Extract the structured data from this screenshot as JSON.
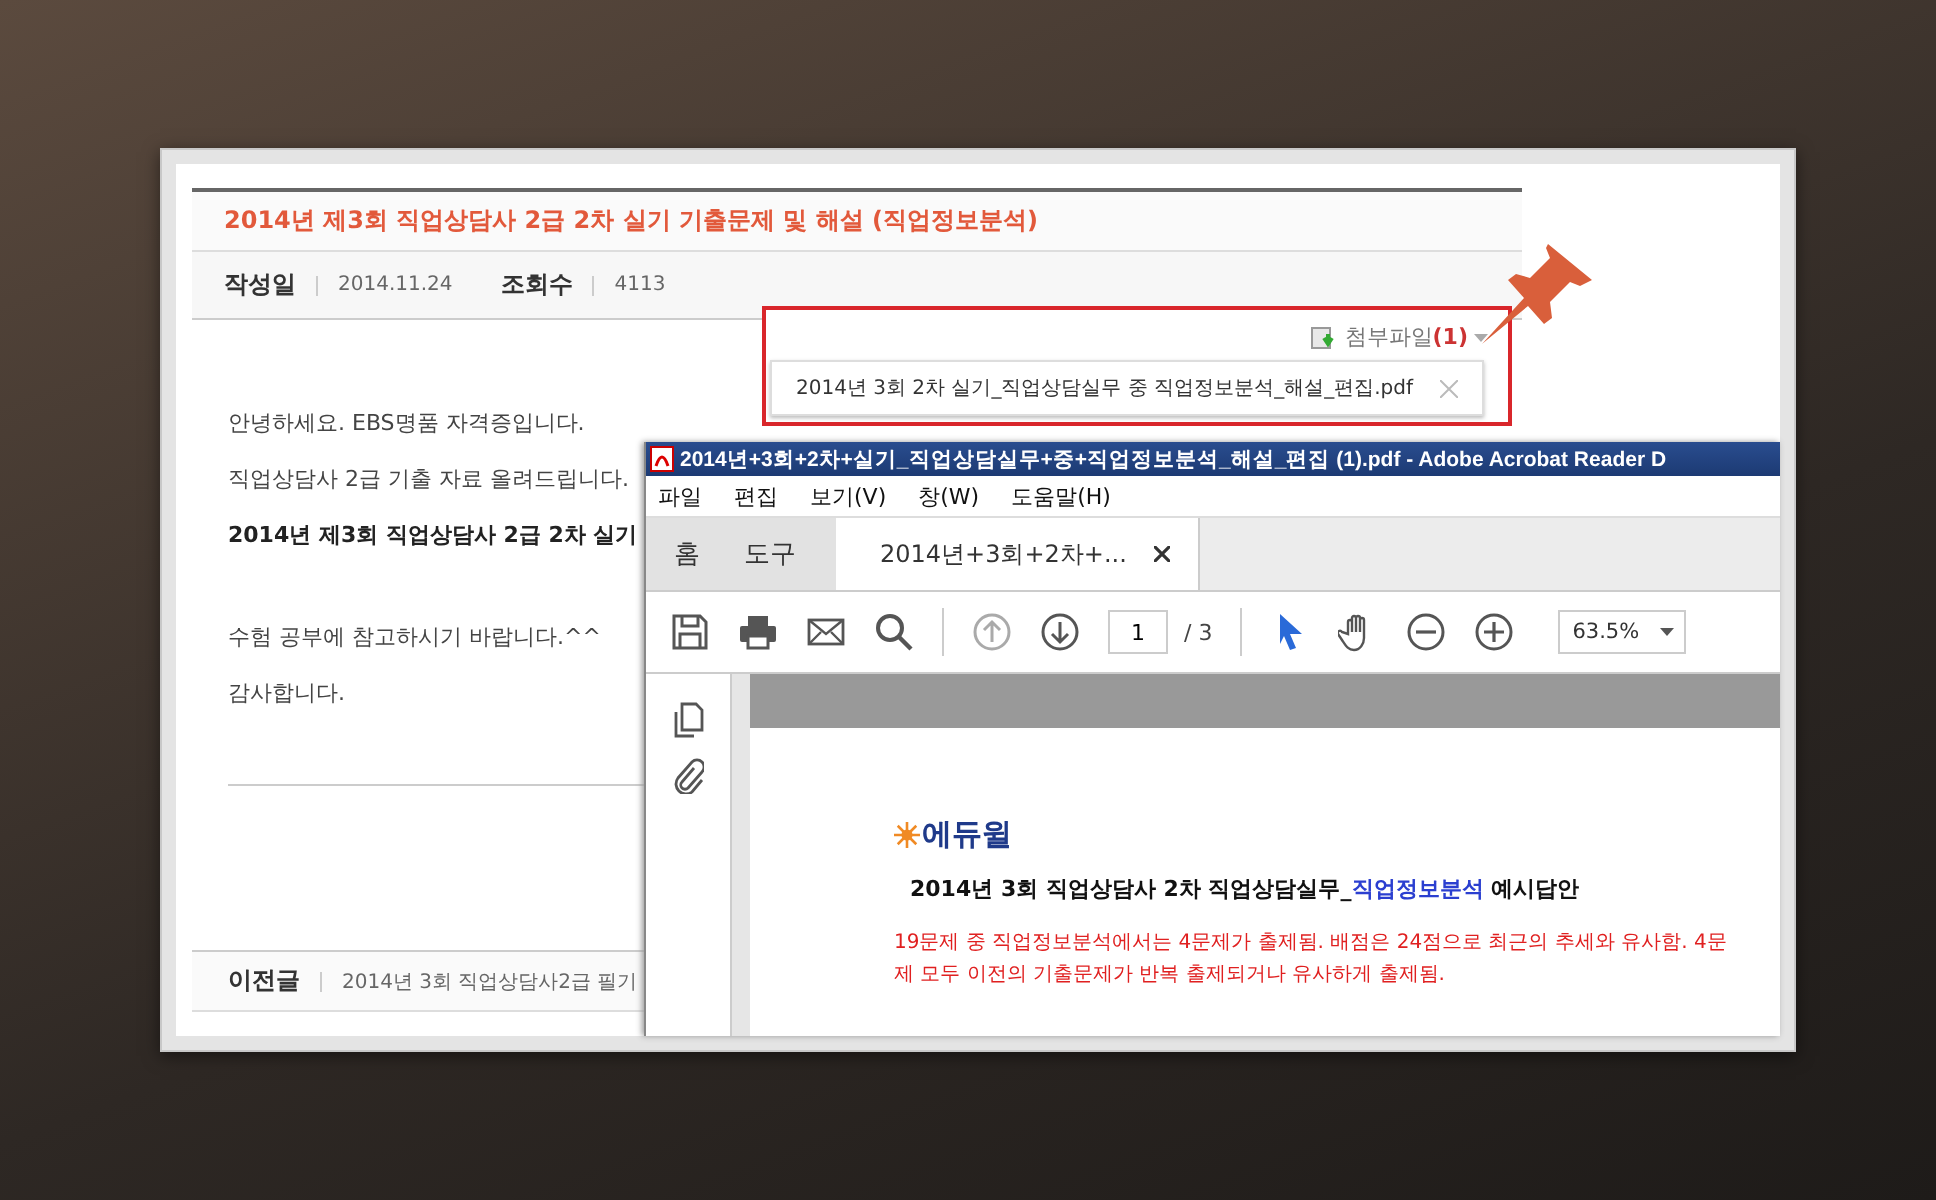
{
  "blog": {
    "title": "2014년 제3회 직업상담사 2급 2차 실기 기출문제 및 해설 (직업정보분석)",
    "meta": [
      {
        "label": "작성일",
        "value": "2014.11.24"
      },
      {
        "label": "조회수",
        "value": "4113"
      }
    ],
    "paragraphs": [
      {
        "text": "안녕하세요. EBS명품 자격증입니다.",
        "bold": false
      },
      {
        "text": "직업상담사 2급 기출 자료 올려드립니다.",
        "bold": false
      },
      {
        "text": "2014년 제3회 직업상담사 2급 2차 실기",
        "bold": true
      },
      {
        "text": "수험 공부에 참고하시기 바랍니다.^^",
        "bold": false
      },
      {
        "text": "감사합니다.",
        "bold": false
      }
    ],
    "prev_post": {
      "label": "이전글",
      "title": "2014년 3회 직업상담사2급 필기"
    }
  },
  "attachments": {
    "label": "첨부파일",
    "count": "(1)",
    "files": [
      "2014년 3회 2차 실기_직업상담실무 중 직업정보분석_해설_편집.pdf"
    ]
  },
  "pdf_window": {
    "title": "2014년+3회+2차+실기_직업상담실무+중+직업정보분석_해설_편집 (1).pdf - Adobe Acrobat Reader D",
    "menu": [
      "파일",
      "편집",
      "보기(V)",
      "창(W)",
      "도움말(H)"
    ],
    "tabs": [
      {
        "label": "홈",
        "selected": false,
        "kind": "nav"
      },
      {
        "label": "도구",
        "selected": false,
        "kind": "nav"
      },
      {
        "label": "2014년+3회+2차+...",
        "selected": true,
        "kind": "document"
      }
    ],
    "page_number": "1",
    "page_total": "/ 3",
    "zoom": "63.5%",
    "document": {
      "logo": "에듀윌",
      "heading": {
        "before": "2014년 3회 직업상담사 2차 직업상담실무_",
        "highlight": "직업정보분석",
        "after": " 예시답안"
      },
      "note": "19문제 중 직업정보분석에서는 4문제가 출제됨. 배점은 24점으로 최근의 추세와 유사함. 4문제 모두 이전의 기출문제가 반복 출제되거나 유사하게 출제됨."
    }
  }
}
